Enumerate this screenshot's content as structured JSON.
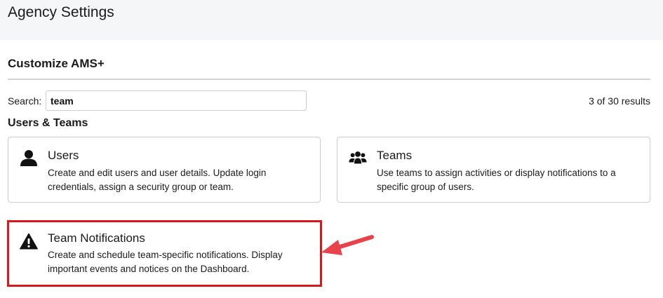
{
  "header": {
    "title": "Agency Settings"
  },
  "section": {
    "title": "Customize AMS+"
  },
  "search": {
    "label": "Search:",
    "value": "team",
    "results": "3 of 30 results"
  },
  "group": {
    "title": "Users & Teams"
  },
  "cards": [
    {
      "icon": "user-icon",
      "title": "Users",
      "description": "Create and edit users and user details. Update login credentials, assign a security group or team."
    },
    {
      "icon": "teams-icon",
      "title": "Teams",
      "description": "Use teams to assign activities or display notifications to a specific group of users."
    },
    {
      "icon": "warning-icon",
      "title": "Team Notifications",
      "description": "Create and schedule team-specific notifications. Display important events and notices on the Dashboard."
    }
  ],
  "colors": {
    "header_bg": "#f5f6f7",
    "highlight": "#d6191f",
    "arrow": "#e8424a",
    "border": "#c9ccd0"
  }
}
